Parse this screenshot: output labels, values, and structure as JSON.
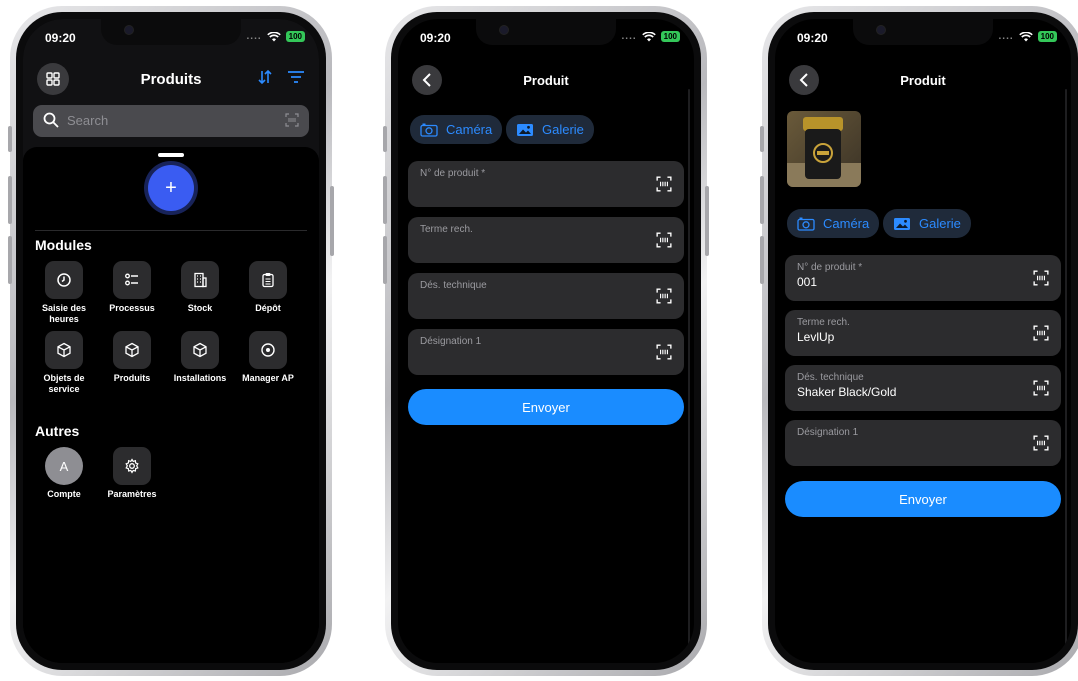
{
  "status": {
    "time": "09:20",
    "battery": "100"
  },
  "screen1": {
    "title": "Produits",
    "search_placeholder": "Search",
    "modules_title": "Modules",
    "modules": [
      {
        "label": "Saisie des heures",
        "icon": "clock-icon"
      },
      {
        "label": "Processus",
        "icon": "list-icon"
      },
      {
        "label": "Stock",
        "icon": "building-icon"
      },
      {
        "label": "Dépôt",
        "icon": "clipboard-icon"
      },
      {
        "label": "Objets de service",
        "icon": "cube-icon"
      },
      {
        "label": "Produits",
        "icon": "cube-icon"
      },
      {
        "label": "Installations",
        "icon": "cube-icon"
      },
      {
        "label": "Manager AP",
        "icon": "target-icon"
      }
    ],
    "others_title": "Autres",
    "others": [
      {
        "label": "Compte",
        "avatar": "A"
      },
      {
        "label": "Paramètres",
        "icon": "gear-icon"
      }
    ]
  },
  "screen2": {
    "title": "Produit",
    "camera": "Caméra",
    "gallery": "Galerie",
    "fields": [
      {
        "label": "N° de produit *",
        "value": ""
      },
      {
        "label": "Terme rech.",
        "value": ""
      },
      {
        "label": "Dés. technique",
        "value": ""
      },
      {
        "label": "Désignation 1",
        "value": ""
      }
    ],
    "send": "Envoyer"
  },
  "screen3": {
    "title": "Produit",
    "camera": "Caméra",
    "gallery": "Galerie",
    "fields": [
      {
        "label": "N° de produit *",
        "value": "001"
      },
      {
        "label": "Terme rech.",
        "value": "LevlUp"
      },
      {
        "label": "Dés. technique",
        "value": "Shaker Black/Gold"
      },
      {
        "label": "Désignation 1",
        "value": ""
      }
    ],
    "send": "Envoyer"
  },
  "colors": {
    "accent": "#1a8cff",
    "fab": "#3a5cf2",
    "battery": "#34c759",
    "field": "#2c2c2e"
  }
}
